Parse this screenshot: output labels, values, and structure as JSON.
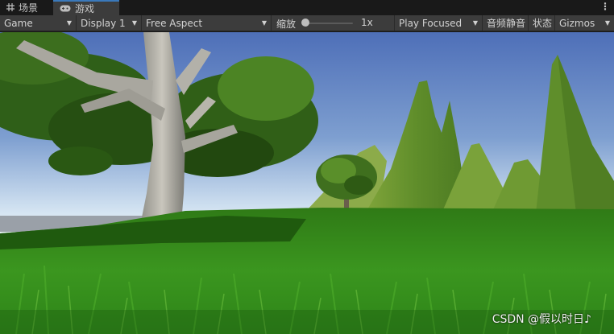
{
  "tabs": [
    {
      "label": "场景",
      "icon": "grid-icon",
      "active": false
    },
    {
      "label": "游戏",
      "icon": "gamepad-icon",
      "active": true
    }
  ],
  "toolbar": {
    "game_dropdown": "Game",
    "display_dropdown": "Display 1",
    "aspect_dropdown": "Free Aspect",
    "scale_label": "缩放",
    "scale_value": "1x",
    "scale_level": 1,
    "play_mode_dropdown": "Play Focused",
    "mute_audio": "音频静音",
    "stats": "状态",
    "gizmos": "Gizmos"
  },
  "viewport": {
    "watermark": "CSDN @假以时日♪"
  },
  "colors": {
    "active_tab_accent": "#3a79bb",
    "toolbar_bg": "#3c3c3c",
    "sky_top": "#4e6fb8",
    "sky_horizon": "#e9f1f8",
    "grass": "#2f8a1c"
  }
}
